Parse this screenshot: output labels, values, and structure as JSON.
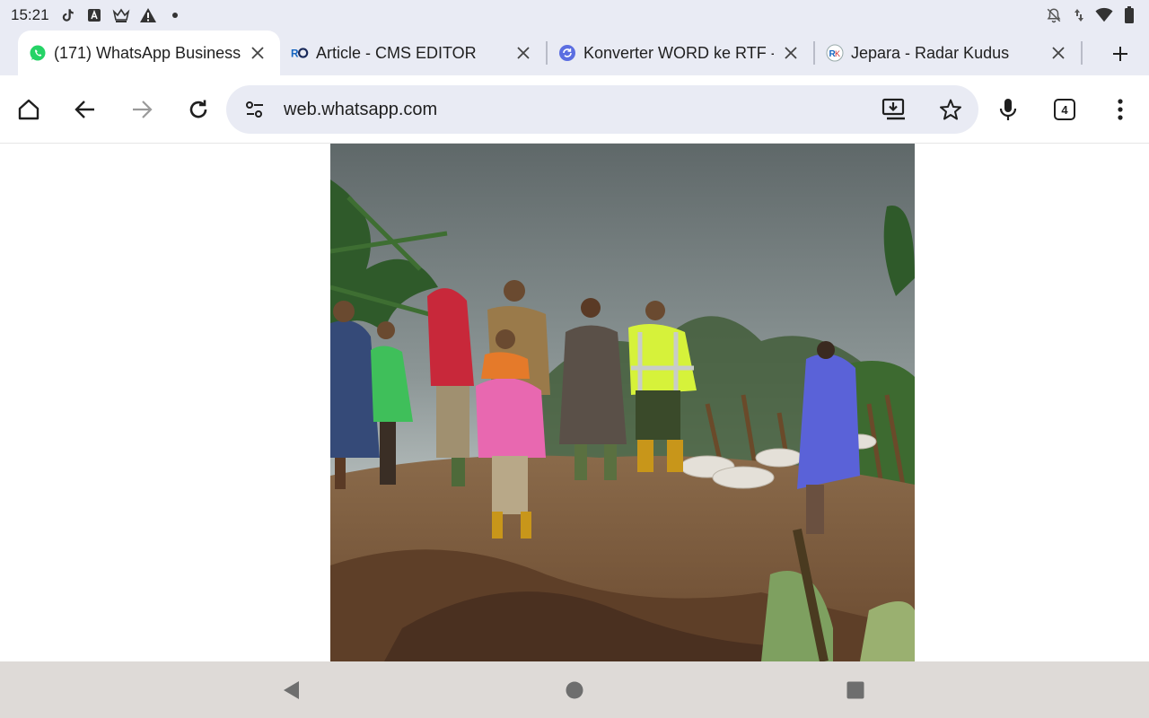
{
  "status_bar": {
    "time": "15:21",
    "left_icons": [
      "tiktok-icon",
      "a-badge-icon",
      "crown-icon",
      "warning-icon",
      "dot-icon"
    ],
    "right_icons": [
      "notifications-off-icon",
      "data-arrows-icon",
      "wifi-icon",
      "battery-icon"
    ]
  },
  "tabs": [
    {
      "title": "(171) WhatsApp Business",
      "favicon": "whatsapp-icon",
      "active": true
    },
    {
      "title": "Article - CMS EDITOR",
      "favicon": "ro-icon",
      "active": false
    },
    {
      "title": "Konverter WORD ke RTF -",
      "favicon": "convert-icon",
      "active": false
    },
    {
      "title": "Jepara - Radar Kudus",
      "favicon": "rk-icon",
      "active": false
    }
  ],
  "toolbar": {
    "url": "web.whatsapp.com",
    "tab_count": "4"
  },
  "colors": {
    "chrome_bg": "#e9ebf4",
    "nav_bar_bg": "#dedad7",
    "whatsapp_green": "#25d366"
  }
}
